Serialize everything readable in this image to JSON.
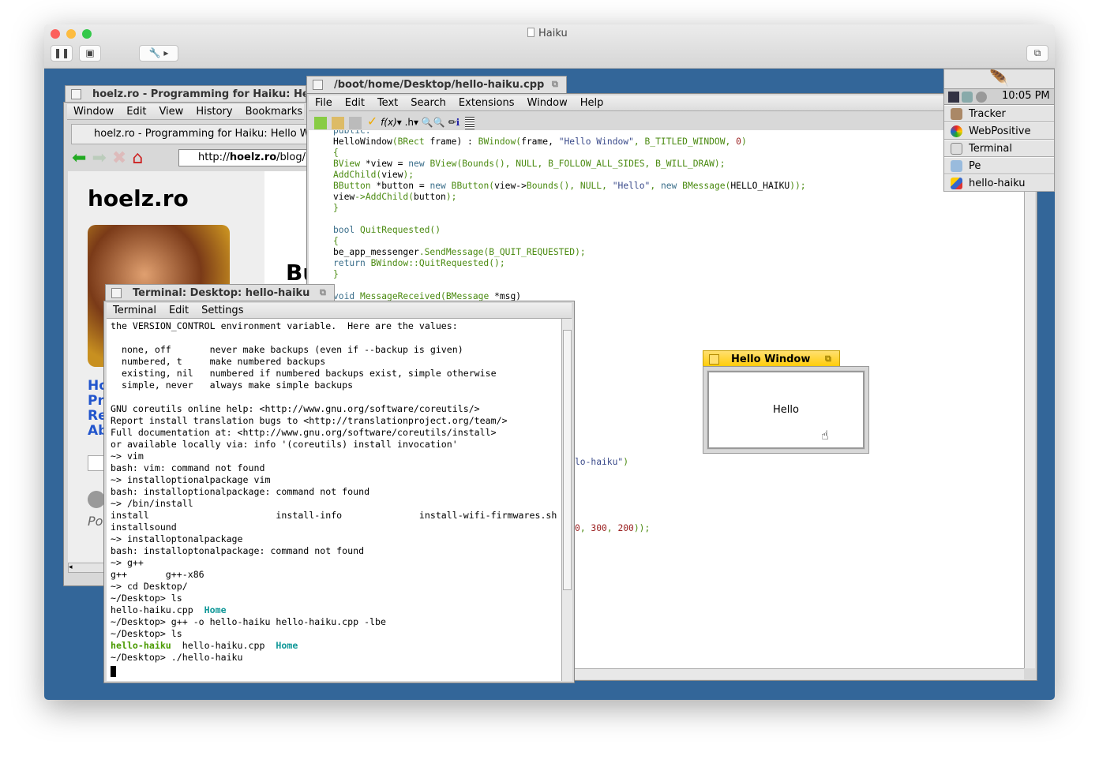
{
  "host": {
    "title": "Haiku"
  },
  "browser": {
    "title": "hoelz.ro - Programming for Haiku: Hell",
    "menu": [
      "Window",
      "Edit",
      "View",
      "History",
      "Bookmarks"
    ],
    "tab_label": "hoelz.ro - Programming for Haiku: Hello Wo",
    "url_prefix": "http://",
    "url_host": "hoelz.ro",
    "url_rest": "/blog/p",
    "site_title": "hoelz.ro",
    "heading_partial": "Bu",
    "nav_links": [
      "Ho",
      "Pr",
      "Re",
      "Ab"
    ],
    "footer_partial": "Po"
  },
  "editor": {
    "title": "/boot/home/Desktop/hello-haiku.cpp",
    "menu": [
      "File",
      "Edit",
      "Text",
      "Search",
      "Extensions",
      "Window",
      "Help"
    ],
    "toolbar": {
      "func_label": "f(x)",
      "header_label": ".h"
    },
    "code": [
      [
        [
          "public:",
          "k"
        ]
      ],
      [
        [
          "HelloWindow",
          "p"
        ],
        [
          "(BRect ",
          "g"
        ],
        [
          "frame) : ",
          "p"
        ],
        [
          "BWindow(",
          "g"
        ],
        [
          "frame, ",
          "p"
        ],
        [
          "\"Hello Window\"",
          "s"
        ],
        [
          ", B_TITLED_WINDOW, ",
          "g"
        ],
        [
          "0",
          "n"
        ],
        [
          ")",
          "g"
        ]
      ],
      [
        [
          "{",
          "g"
        ]
      ],
      [
        [
          "BView ",
          "g"
        ],
        [
          "*view = ",
          "p"
        ],
        [
          "new ",
          "k"
        ],
        [
          "BView(Bounds(), NULL, B_FOLLOW_ALL_SIDES, B_WILL_DRAW);",
          "g"
        ]
      ],
      [
        [
          "AddChild(",
          "g"
        ],
        [
          "view",
          "p"
        ],
        [
          ");",
          "g"
        ]
      ],
      [
        [
          "BButton ",
          "g"
        ],
        [
          "*button = ",
          "p"
        ],
        [
          "new ",
          "k"
        ],
        [
          "BButton(",
          "g"
        ],
        [
          "view->",
          "p"
        ],
        [
          "Bounds(), NULL, ",
          "g"
        ],
        [
          "\"Hello\"",
          "s"
        ],
        [
          ", ",
          "g"
        ],
        [
          "new ",
          "k"
        ],
        [
          "BMessage(",
          "g"
        ],
        [
          "HELLO_HAIKU",
          "p"
        ],
        [
          "));",
          "g"
        ]
      ],
      [
        [
          "view",
          "p"
        ],
        [
          "->AddChild(",
          "g"
        ],
        [
          "button",
          "p"
        ],
        [
          ");",
          "g"
        ]
      ],
      [
        [
          "}",
          "g"
        ]
      ],
      [],
      [
        [
          "bool ",
          "k"
        ],
        [
          "QuitRequested()",
          "g"
        ]
      ],
      [
        [
          "{",
          "g"
        ]
      ],
      [
        [
          "be_app_messenger",
          "p"
        ],
        [
          ".SendMessage(B_QUIT_REQUESTED);",
          "g"
        ]
      ],
      [
        [
          "return ",
          "k"
        ],
        [
          "BWindow::QuitRequested();",
          "g"
        ]
      ],
      [
        [
          "}",
          "g"
        ]
      ],
      [],
      [
        [
          "void ",
          "k"
        ],
        [
          "MessageReceived(BMessage ",
          "g"
        ],
        [
          "*msg)",
          "p"
        ]
      ]
    ],
    "fragment_1": [
      [
        "lo-haiku\"",
        "s"
      ],
      [
        ")",
        "g"
      ]
    ],
    "fragment_2": [
      [
        "0",
        "n"
      ],
      [
        ", ",
        "g"
      ],
      [
        "300",
        "n"
      ],
      [
        ", ",
        "g"
      ],
      [
        "200",
        "n"
      ],
      [
        "));",
        "g"
      ]
    ]
  },
  "terminal": {
    "title": "Terminal: Desktop: hello-haiku",
    "menu": [
      "Terminal",
      "Edit",
      "Settings"
    ],
    "lines": [
      [
        [
          "the VERSION_CONTROL environment variable.  Here are the values:",
          ""
        ]
      ],
      [],
      [
        [
          "  none, off       never make backups (even if --backup is given)",
          ""
        ]
      ],
      [
        [
          "  numbered, t     make numbered backups",
          ""
        ]
      ],
      [
        [
          "  existing, nil   numbered if numbered backups exist, simple otherwise",
          ""
        ]
      ],
      [
        [
          "  simple, never   always make simple backups",
          ""
        ]
      ],
      [],
      [
        [
          "GNU coreutils online help: <http://www.gnu.org/software/coreutils/>",
          ""
        ]
      ],
      [
        [
          "Report install translation bugs to <http://translationproject.org/team/>",
          ""
        ]
      ],
      [
        [
          "Full documentation at: <http://www.gnu.org/software/coreutils/install>",
          ""
        ]
      ],
      [
        [
          "or available locally via: info '(coreutils) install invocation'",
          ""
        ]
      ],
      [
        [
          "~> vim",
          ""
        ]
      ],
      [
        [
          "bash: vim: command not found",
          ""
        ]
      ],
      [
        [
          "~> installoptionalpackage vim",
          ""
        ]
      ],
      [
        [
          "bash: installoptionalpackage: command not found",
          ""
        ]
      ],
      [
        [
          "~> /bin/install",
          ""
        ]
      ],
      [
        [
          "install                       install-info              install-wifi-firmwares.sh",
          ""
        ]
      ],
      [
        [
          "installsound",
          ""
        ]
      ],
      [
        [
          "~> installoptonalpackage",
          ""
        ]
      ],
      [
        [
          "bash: installoptonalpackage: command not found",
          ""
        ]
      ],
      [
        [
          "~> g++",
          ""
        ]
      ],
      [
        [
          "g++       g++-x86",
          ""
        ]
      ],
      [
        [
          "~> cd Desktop/",
          ""
        ]
      ],
      [
        [
          "~/Desktop> ls",
          ""
        ]
      ],
      [
        [
          "hello-haiku.cpp  ",
          ""
        ],
        [
          "Home",
          "tc"
        ]
      ],
      [
        [
          "~/Desktop> g++ -o hello-haiku hello-haiku.cpp -lbe",
          ""
        ]
      ],
      [
        [
          "~/Desktop> ls",
          ""
        ]
      ],
      [
        [
          "hello-haiku",
          "tg"
        ],
        [
          "  hello-haiku.cpp  ",
          ""
        ],
        [
          "Home",
          "tc"
        ]
      ],
      [
        [
          "~/Desktop> ./hello-haiku",
          ""
        ]
      ]
    ]
  },
  "hello_window": {
    "title": "Hello Window",
    "button_label": "Hello",
    "accent": "#ffcb00"
  },
  "deskbar": {
    "clock": "10:05 PM",
    "items": [
      {
        "label": "Tracker",
        "icon": "tracker-icon"
      },
      {
        "label": "WebPositive",
        "icon": "webpositive-icon"
      },
      {
        "label": "Terminal",
        "icon": "terminal-icon"
      },
      {
        "label": "Pe",
        "icon": "pe-icon"
      },
      {
        "label": "hello-haiku",
        "icon": "app-icon"
      }
    ]
  },
  "colors": {
    "desktop": "#336699",
    "haiku_yellow": "#ffcb00",
    "link_blue": "#2255cc"
  }
}
